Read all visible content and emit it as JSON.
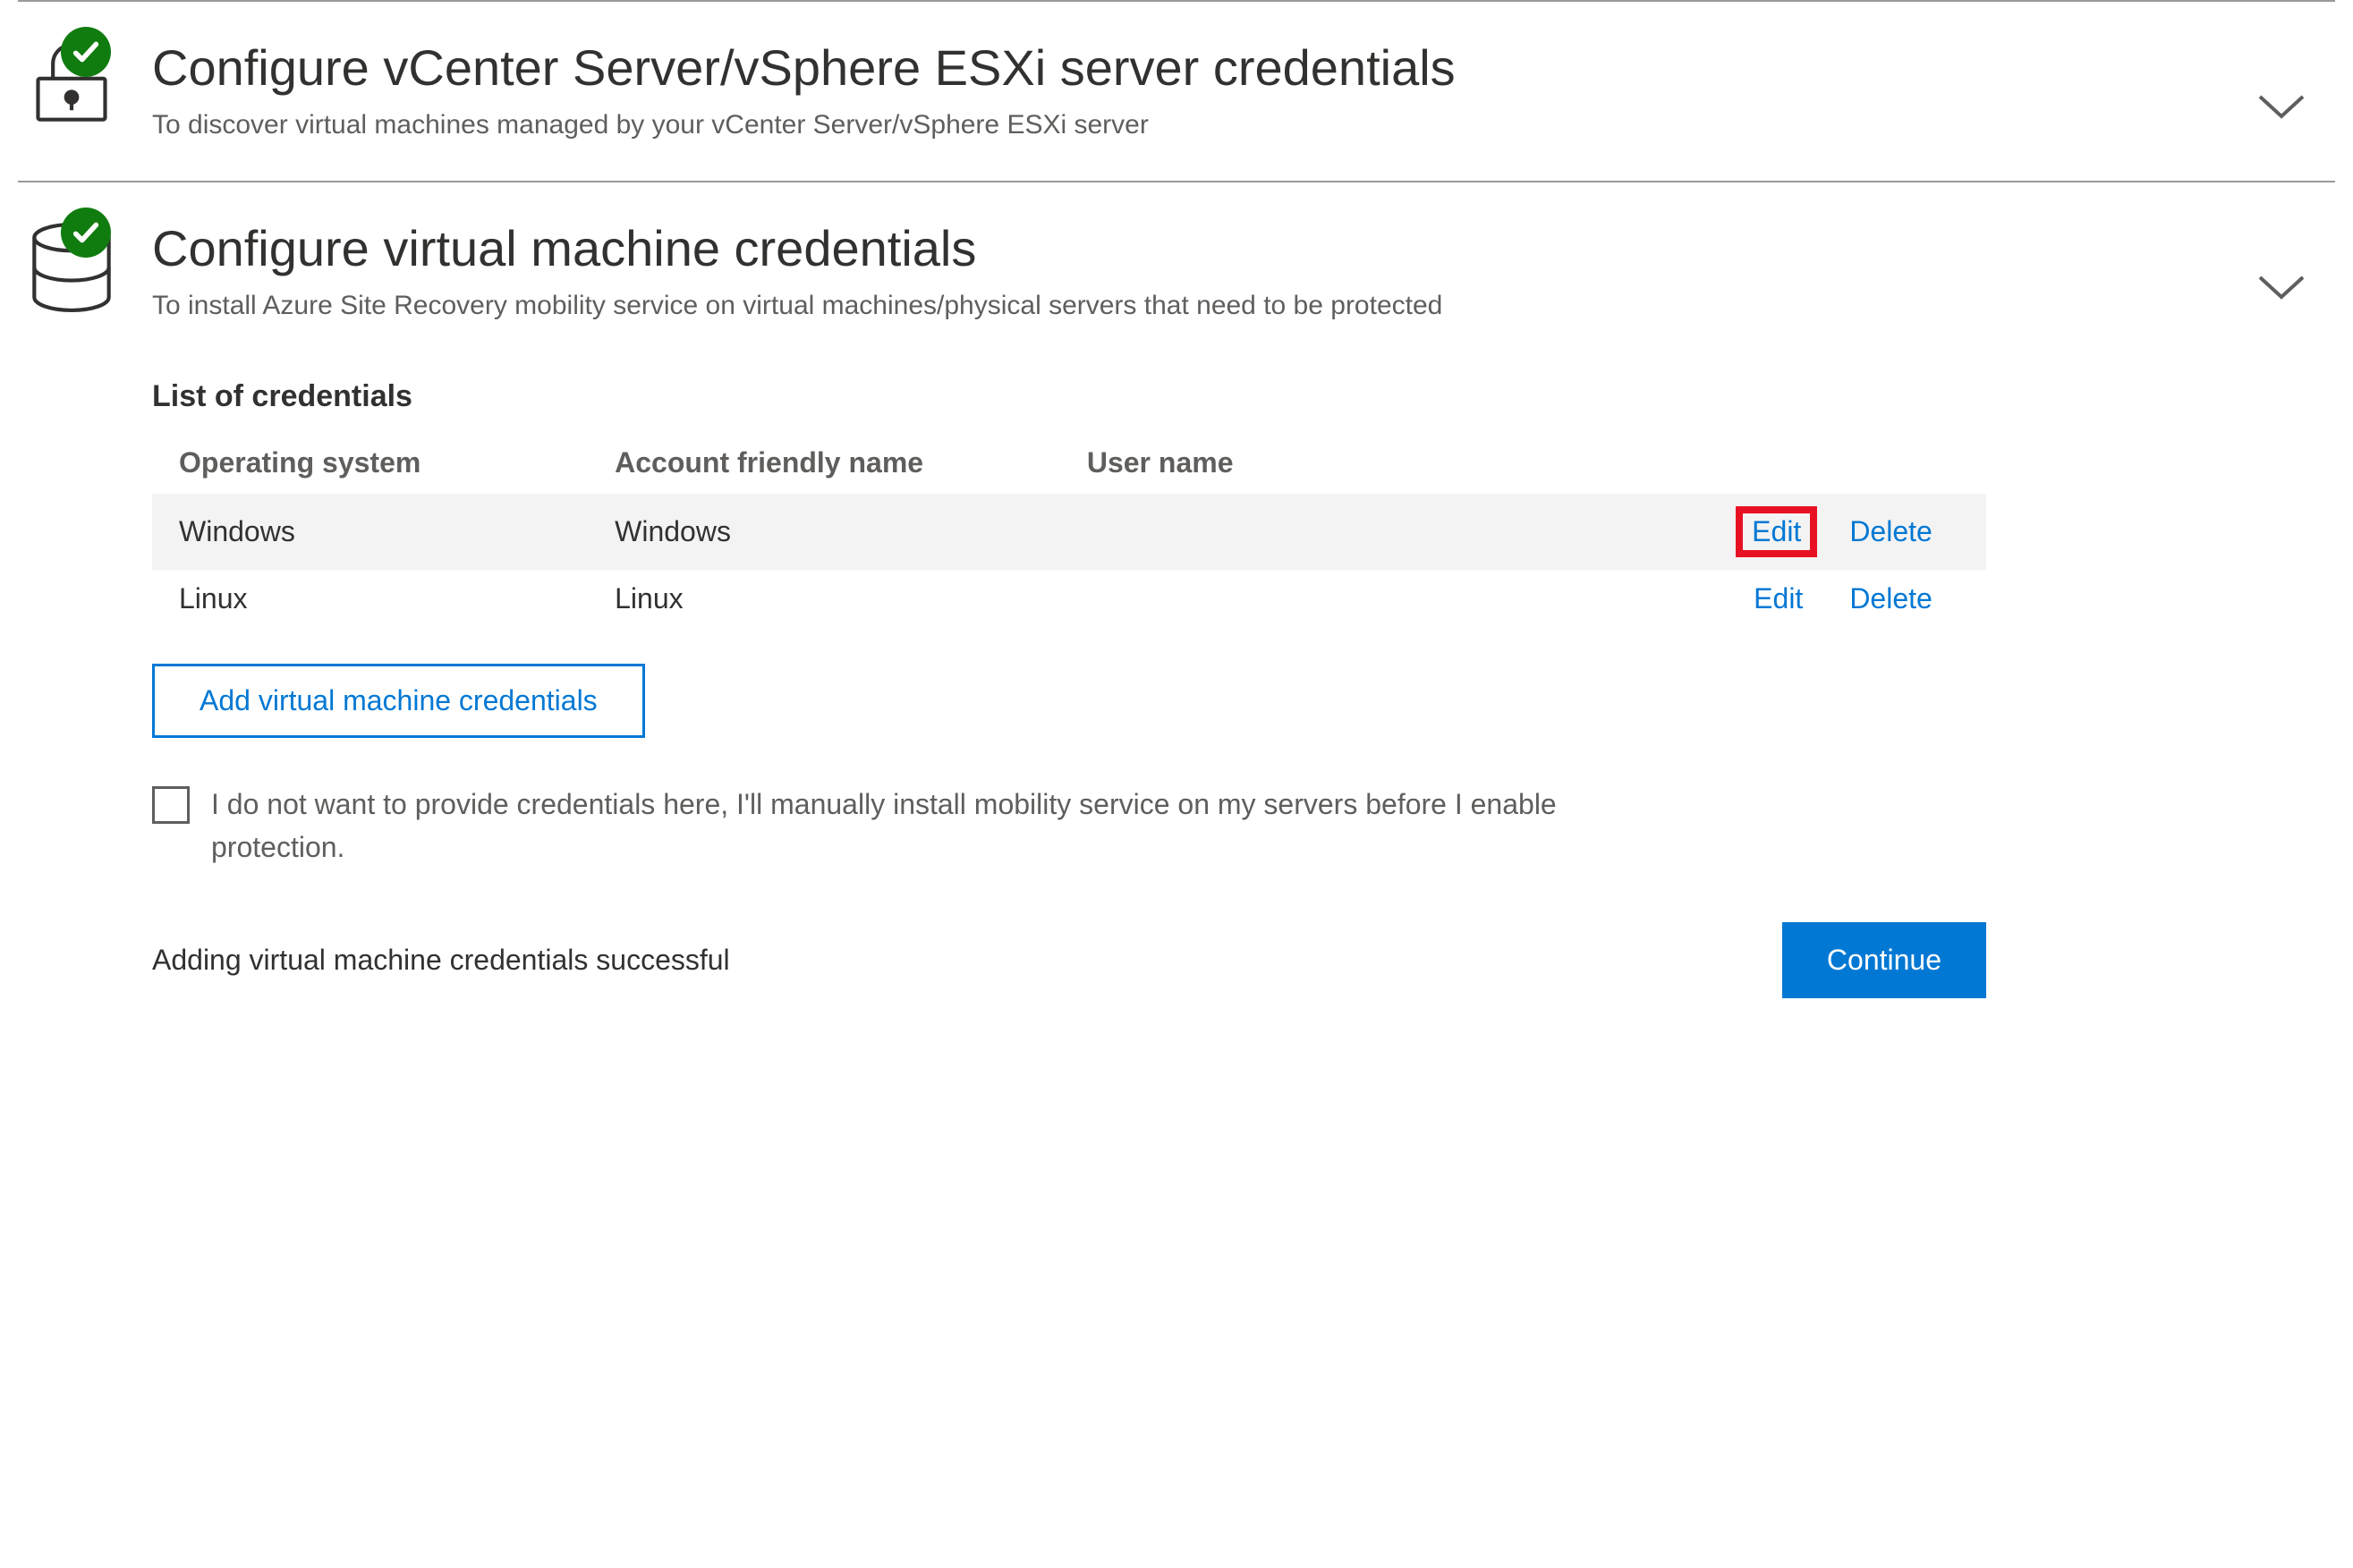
{
  "section1": {
    "title": "Configure vCenter Server/vSphere ESXi server credentials",
    "subtitle": "To discover virtual machines managed by your vCenter Server/vSphere ESXi server"
  },
  "section2": {
    "title": "Configure virtual machine credentials",
    "subtitle": "To install Azure Site Recovery mobility service on virtual machines/physical servers that need to be protected",
    "list_title": "List of credentials",
    "columns": {
      "os": "Operating system",
      "account": "Account friendly name",
      "user": "User name"
    },
    "rows": [
      {
        "os": "Windows",
        "account": "Windows",
        "user": "",
        "edit": "Edit",
        "delete": "Delete"
      },
      {
        "os": "Linux",
        "account": "Linux",
        "user": "",
        "edit": "Edit",
        "delete": "Delete"
      }
    ],
    "add_button": "Add virtual machine credentials",
    "opt_out": "I do not want to provide credentials here, I'll manually install mobility service on my servers before I enable protection.",
    "status": "Adding virtual machine credentials successful",
    "continue": "Continue"
  }
}
